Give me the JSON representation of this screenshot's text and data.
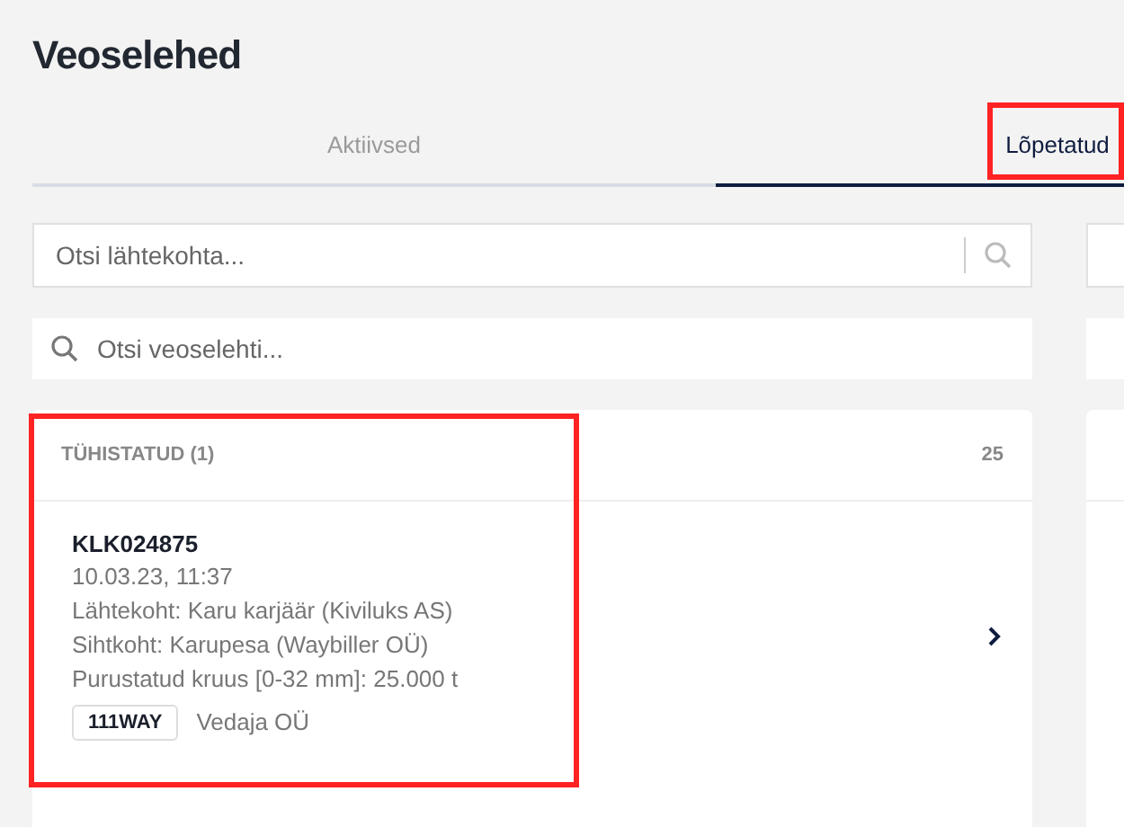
{
  "page_title": "Veoselehed",
  "tabs": [
    {
      "label": "Aktiivsed",
      "selected": false,
      "highlighted": false
    },
    {
      "label": "Lõpetatud",
      "selected": true,
      "highlighted": true
    }
  ],
  "columns": [
    {
      "origin_search": {
        "placeholder": "Otsi lähtekohta..."
      },
      "waybill_search": {
        "placeholder": "Otsi veoselehti..."
      },
      "group": {
        "title": "TÜHISTATUD (1)",
        "count": "25",
        "highlighted": true,
        "items": [
          {
            "number": "KLK024875",
            "datetime": "10.03.23, 11:37",
            "origin": "Lähtekoht: Karu karjäär (Kiviluks AS)",
            "destination": "Sihtkoht: Karupesa (Waybiller OÜ)",
            "cargo": "Purustatud kruus [0-32 mm]: 25.000 t",
            "vehicle": "111WAY",
            "carrier": "Vedaja OÜ"
          }
        ]
      }
    },
    {
      "group": {
        "highlighted": false
      }
    }
  ]
}
